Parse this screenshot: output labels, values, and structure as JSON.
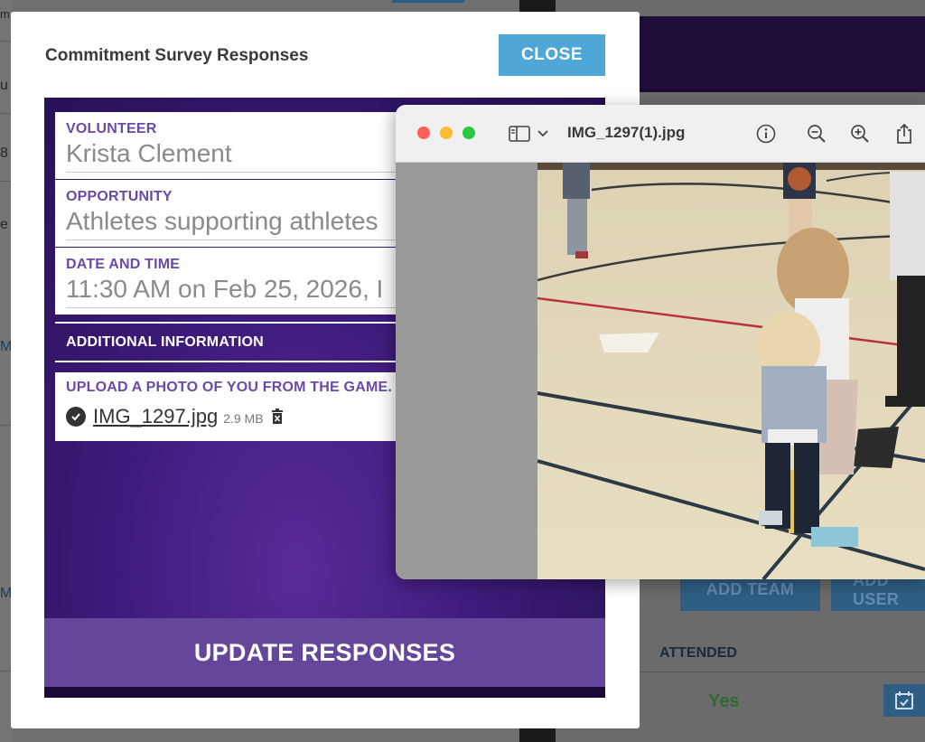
{
  "modal": {
    "title": "Commitment Survey Responses",
    "close_label": "CLOSE",
    "fields": [
      {
        "label": "VOLUNTEER",
        "value": "Krista Clement"
      },
      {
        "label": "OPPORTUNITY",
        "value": "Athletes supporting athletes"
      },
      {
        "label": "DATE AND TIME",
        "value": "11:30 AM on Feb 25, 2026, I"
      }
    ],
    "additional_info_label": "ADDITIONAL INFORMATION",
    "upload": {
      "label": "UPLOAD A PHOTO OF YOU FROM THE GAME.",
      "file_name": "IMG_1297.jpg",
      "file_size": "2.9 MB"
    },
    "update_label": "UPDATE RESPONSES"
  },
  "preview": {
    "file_title": "IMG_1297(1).jpg"
  },
  "background": {
    "left_fragments": [
      "m",
      "u",
      "8",
      "e",
      "M",
      "M"
    ],
    "add_team_label": "ADD TEAM",
    "add_user_label": "ADD USER",
    "attended_header": "ATTENDED",
    "attended_value": "Yes"
  },
  "colors": {
    "primary_purple": "#3b1a78",
    "label_purple": "#6a4aa8",
    "close_blue": "#4ea7d6",
    "update_button": "#64479a"
  },
  "icons": [
    "check-circle-icon",
    "trash-icon",
    "sidebar-toggle-icon",
    "chevron-down-icon",
    "info-icon",
    "zoom-out-icon",
    "zoom-in-icon",
    "share-icon",
    "calendar-check-icon"
  ]
}
